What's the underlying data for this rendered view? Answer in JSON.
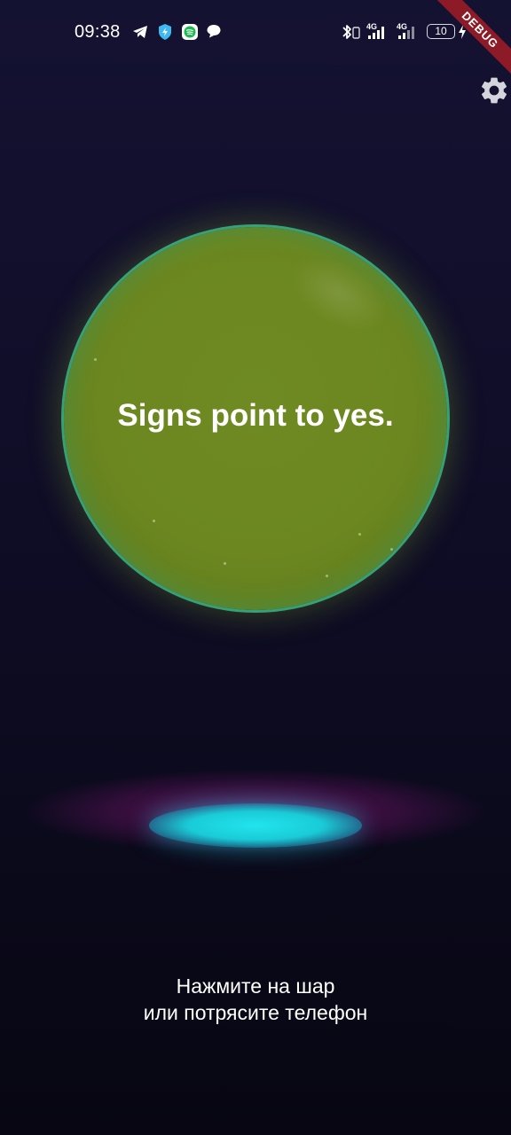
{
  "status_bar": {
    "time": "09:38",
    "left_icons": [
      "telegram-icon",
      "shield-vpn-icon",
      "spotify-icon",
      "chat-bubble-icon"
    ],
    "right_icons": [
      "bluetooth-icon",
      "signal-4g-icon",
      "signal-4g-icon",
      "battery-icon",
      "charging-icon"
    ],
    "signal_label_1": "4G",
    "signal_label_2": "4G",
    "battery_level": "10"
  },
  "debug_banner": "DEBUG",
  "settings": {
    "icon": "gear-icon"
  },
  "orb": {
    "answer": "Signs point to yes.",
    "color": "#6c8720",
    "rim_color": "#3cc896"
  },
  "hint": {
    "line1": "Нажмите на шар",
    "line2": "или потрясите телефон"
  },
  "colors": {
    "background": "#0f0d26",
    "pedestal_glow": "#22e4ec",
    "pedestal_halo": "#aa1e8c"
  }
}
